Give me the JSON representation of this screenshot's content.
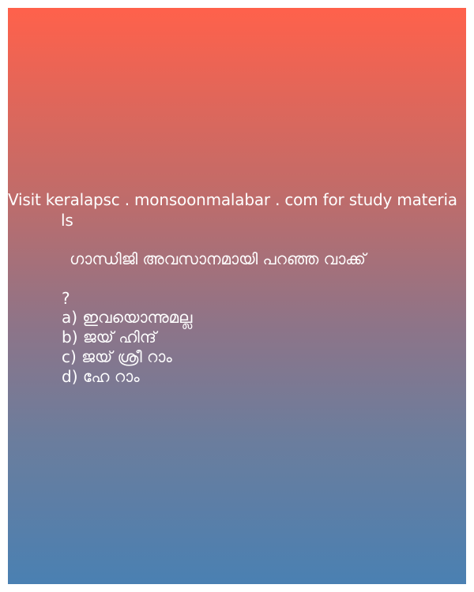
{
  "promo": {
    "line1": "Visit keralapsc . monsoonmalabar . com for study materia",
    "line2": "ls"
  },
  "question": {
    "text": "ഗാന്ധിജി അവസാനമായി പറഞ്ഞ വാക്ക്",
    "mark": "?"
  },
  "options": [
    "a) ഇവയൊന്നുമല്ല",
    "b) ജയ് ഹിന്ദ്",
    "c) ജയ് ശ്രീ റാം",
    "d) ഹേ റാം"
  ]
}
